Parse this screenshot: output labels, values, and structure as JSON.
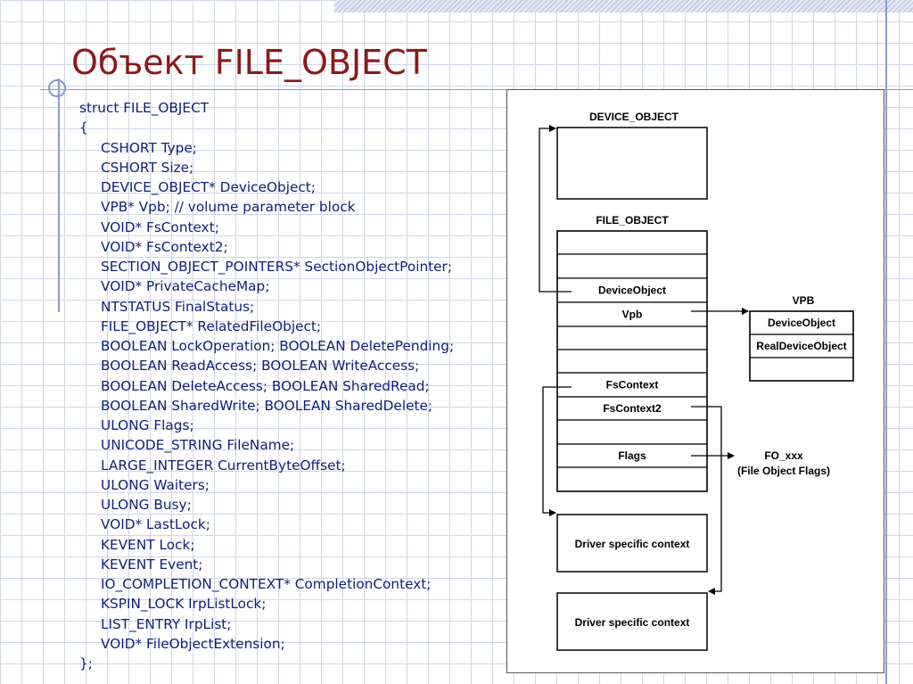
{
  "slide": {
    "title": "Объект FILE_OBJECT",
    "code_lines": [
      {
        "text": "struct FILE_OBJECT",
        "indent": false
      },
      {
        "text": "{",
        "indent": false
      },
      {
        "text": "CSHORT Type;",
        "indent": true
      },
      {
        "text": "CSHORT Size;",
        "indent": true
      },
      {
        "text": "DEVICE_OBJECT* DeviceObject;",
        "indent": true
      },
      {
        "text": "VPB* Vpb; // volume parameter block",
        "indent": true
      },
      {
        "text": "VOID* FsContext;",
        "indent": true
      },
      {
        "text": "VOID* FsContext2;",
        "indent": true
      },
      {
        "text": "SECTION_OBJECT_POINTERS* SectionObjectPointer;",
        "indent": true
      },
      {
        "text": "VOID* PrivateCacheMap;",
        "indent": true
      },
      {
        "text": "NTSTATUS FinalStatus;",
        "indent": true
      },
      {
        "text": "FILE_OBJECT* RelatedFileObject;",
        "indent": true
      },
      {
        "text": "BOOLEAN LockOperation; BOOLEAN DeletePending;",
        "indent": true
      },
      {
        "text": "BOOLEAN ReadAccess; BOOLEAN WriteAccess;",
        "indent": true
      },
      {
        "text": "BOOLEAN DeleteAccess; BOOLEAN SharedRead;",
        "indent": true
      },
      {
        "text": "BOOLEAN SharedWrite; BOOLEAN SharedDelete;",
        "indent": true
      },
      {
        "text": "ULONG Flags;",
        "indent": true
      },
      {
        "text": "UNICODE_STRING FileName;",
        "indent": true
      },
      {
        "text": "LARGE_INTEGER CurrentByteOffset;",
        "indent": true
      },
      {
        "text": "ULONG Waiters;",
        "indent": true
      },
      {
        "text": "ULONG Busy;",
        "indent": true
      },
      {
        "text": "VOID* LastLock;",
        "indent": true
      },
      {
        "text": "KEVENT Lock;",
        "indent": true
      },
      {
        "text": "KEVENT Event;",
        "indent": true
      },
      {
        "text": "IO_COMPLETION_CONTEXT* CompletionContext;",
        "indent": true
      },
      {
        "text": "KSPIN_LOCK IrpListLock;",
        "indent": true
      },
      {
        "text": "LIST_ENTRY IrpList;",
        "indent": true
      },
      {
        "text": "VOID* FileObjectExtension;",
        "indent": true
      },
      {
        "text": "};",
        "indent": false
      }
    ]
  },
  "diagram": {
    "device_object_label": "DEVICE_OBJECT",
    "file_object_label": "FILE_OBJECT",
    "file_object_rows": [
      "",
      "",
      "DeviceObject",
      "Vpb",
      "",
      "",
      "FsContext",
      "FsContext2",
      "",
      "Flags",
      ""
    ],
    "vpb_label": "VPB",
    "vpb_rows": [
      "DeviceObject",
      "RealDeviceObject",
      ""
    ],
    "flags_target_line1": "FO_xxx",
    "flags_target_line2": "(File Object Flags)",
    "context_box_1": "Driver specific context",
    "context_box_2": "Driver specific context"
  },
  "colors": {
    "title": "#8b1a1a",
    "code_text": "#10207c",
    "accent_lines": "#8a9bd0"
  }
}
